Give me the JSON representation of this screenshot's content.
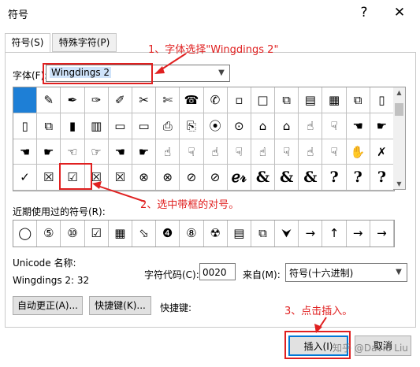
{
  "dialog": {
    "title": "符号",
    "help": "?",
    "close": "✕"
  },
  "tabs": [
    {
      "label": "符号(S)"
    },
    {
      "label": "特殊字符(P)"
    }
  ],
  "font": {
    "label": "字体(F):",
    "value": "Wingdings 2"
  },
  "grid": {
    "rows": [
      [
        "",
        "✎",
        "✒",
        "✑",
        "✐",
        "✂",
        "✄",
        "☎",
        "✆",
        "▫",
        "□",
        "⧉",
        "▤",
        "▦",
        "⧉",
        "▯"
      ],
      [
        "▯",
        "⧉",
        "▮",
        "▥",
        "▭",
        "▭",
        "⎙",
        "⎘",
        "⦿",
        "⊙",
        "⌂",
        "⌂",
        "☝",
        "☟",
        "☚",
        "☛"
      ],
      [
        "☚",
        "☛",
        "☜",
        "☞",
        "☚",
        "☛",
        "☝",
        "☟",
        "☝",
        "☟",
        "☝",
        "☟",
        "☝",
        "☟",
        "✋",
        "✗"
      ],
      [
        "✓",
        "☒",
        "☑",
        "☒",
        "☒",
        "⊗",
        "⊗",
        "⊘",
        "⊘",
        "ℯ𝓇",
        "&",
        "&",
        "&",
        "?",
        "?",
        "?"
      ]
    ]
  },
  "recent": {
    "label": "近期使用过的符号(R):",
    "symbols": [
      "◯",
      "⑤",
      "⑩",
      "☑",
      "▦",
      "⬂",
      "❹",
      "⑧",
      "☢",
      "▤",
      "⧉",
      "⮟",
      "→",
      "↑",
      "→",
      "→"
    ]
  },
  "unicode": {
    "name_label": "Unicode 名称:",
    "name_value": "Wingdings 2: 32"
  },
  "char_code": {
    "label": "字符代码(C):",
    "value": "0020"
  },
  "from": {
    "label": "来自(M):",
    "value": "符号(十六进制)"
  },
  "buttons": {
    "autocorrect": "自动更正(A)...",
    "shortcut_key": "快捷键(K)...",
    "shortcut_label": "快捷键:",
    "insert": "插入(I)",
    "cancel": "取消"
  },
  "annotations": {
    "step1": "1、字体选择\"Wingdings 2\"",
    "step2": "2、选中带框的对号。",
    "step3": "3、点击插入。",
    "watermark": "知乎 @David Liu"
  },
  "colors": {
    "annotation": "#e02020",
    "selected_cell": "#1e7fd6"
  }
}
